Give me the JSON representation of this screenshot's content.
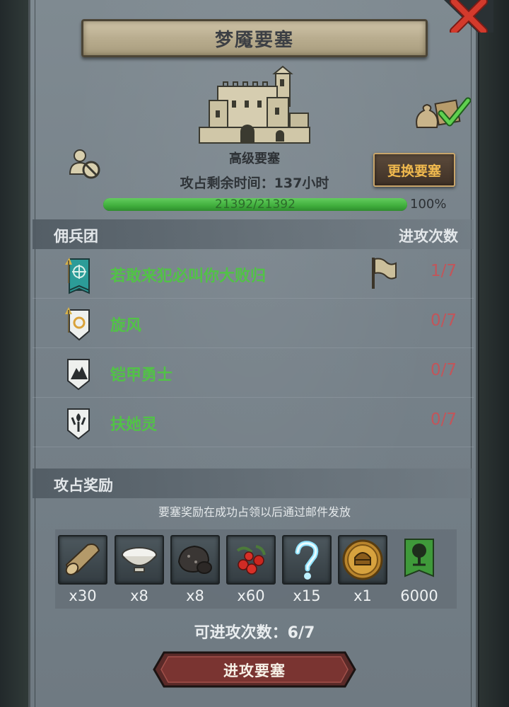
{
  "title": "梦魇要塞",
  "fortress": {
    "grade": "高级要塞",
    "time_label": "攻占剩余时间：",
    "time_value": "137",
    "time_unit": "小时",
    "change_button": "更换要塞"
  },
  "progress": {
    "text": "21392/21392",
    "percent_label": "100%",
    "fraction": 1.0
  },
  "mercenary_section": {
    "title": "佣兵团",
    "attack_count_header": "进攻次数",
    "rows": [
      {
        "name": "若敢来犯必叫你大败归",
        "count": "1/7",
        "icon": "teal-banner-icon",
        "has_flag": true
      },
      {
        "name": "旋风",
        "count": "0/7",
        "icon": "white-shield-sun-icon",
        "has_flag": false
      },
      {
        "name": "铠甲勇士",
        "count": "0/7",
        "icon": "white-shield-mountain-icon",
        "has_flag": false
      },
      {
        "name": "扶她灵",
        "count": "0/7",
        "icon": "white-shield-torch-icon",
        "has_flag": false
      }
    ]
  },
  "reward_section": {
    "title": "攻占奖励",
    "note": "要塞奖励在成功占领以后通过邮件发放",
    "items": [
      {
        "icon": "wood-log-icon",
        "qty": "x30"
      },
      {
        "icon": "milk-bowl-icon",
        "qty": "x8"
      },
      {
        "icon": "ore-stone-icon",
        "qty": "x8"
      },
      {
        "icon": "berries-icon",
        "qty": "x60"
      },
      {
        "icon": "mystery-question-icon",
        "qty": "x15"
      },
      {
        "icon": "knight-helmet-coin-icon",
        "qty": "x1"
      },
      {
        "icon": "tree-banner-icon",
        "qty": "6000"
      }
    ]
  },
  "attacks_remaining": "可进攻次数：6/7",
  "attack_button": "进攻要塞",
  "colors": {
    "name_green": "#52c247",
    "count_red": "#c2555a",
    "change_button_text": "#f0b94e"
  }
}
